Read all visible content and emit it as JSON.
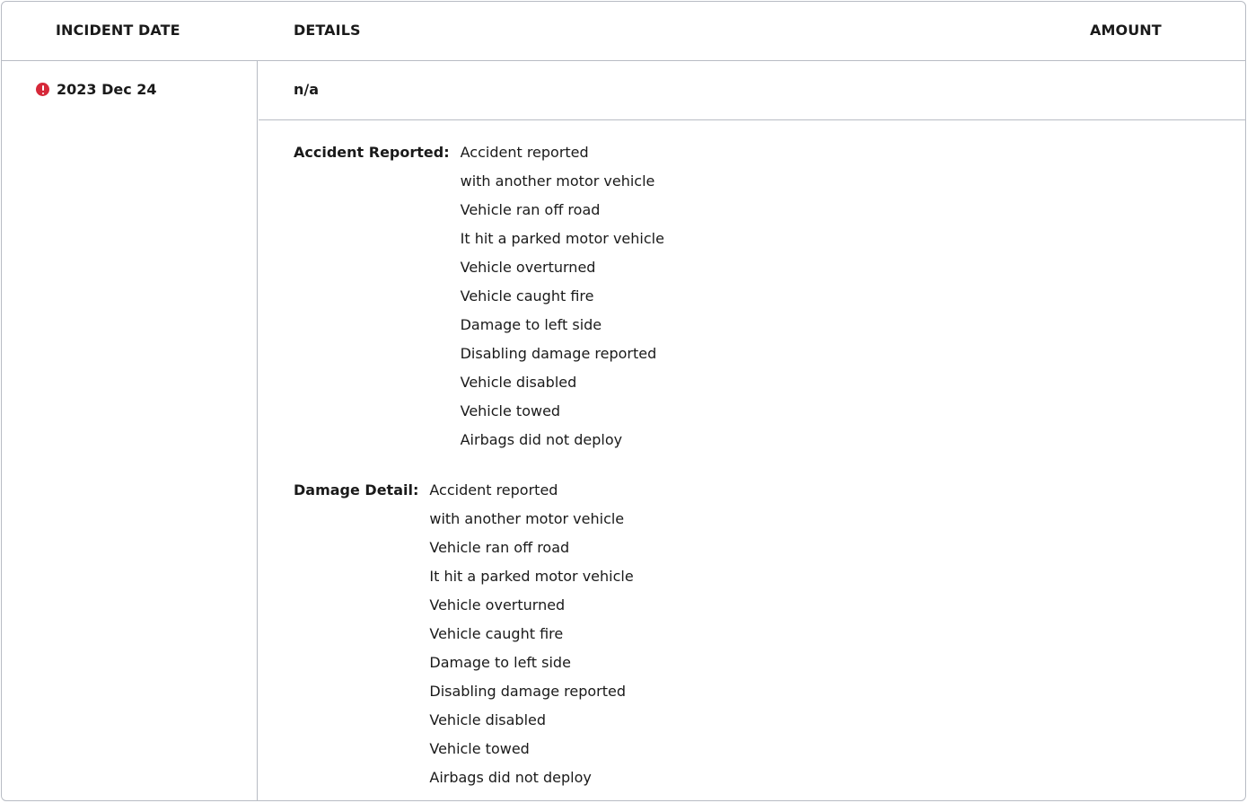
{
  "table": {
    "headers": {
      "incident_date": "INCIDENT DATE",
      "details": "DETAILS",
      "amount": "AMOUNT"
    },
    "rows": [
      {
        "status_icon": "alert-circle-icon",
        "status_color": "#d62839",
        "date": "2023 Dec 24",
        "summary": "n/a",
        "amount": "",
        "sections": [
          {
            "label": "Accident Reported:",
            "lines": [
              "Accident reported",
              "with another motor vehicle",
              "Vehicle ran off road",
              "It hit a parked motor vehicle",
              "Vehicle overturned",
              "Vehicle caught fire",
              "Damage to left side",
              "Disabling damage reported",
              "Vehicle disabled",
              "Vehicle towed",
              "Airbags did not deploy"
            ]
          },
          {
            "label": "Damage Detail:",
            "lines": [
              "Accident reported",
              "with another motor vehicle",
              "Vehicle ran off road",
              "It hit a parked motor vehicle",
              "Vehicle overturned",
              "Vehicle caught fire",
              "Damage to left side",
              "Disabling damage reported",
              "Vehicle disabled",
              "Vehicle towed",
              "Airbags did not deploy"
            ]
          }
        ]
      }
    ]
  },
  "colors": {
    "border": "#b8bcc4",
    "text": "#1a1a1a",
    "alert": "#d62839"
  }
}
